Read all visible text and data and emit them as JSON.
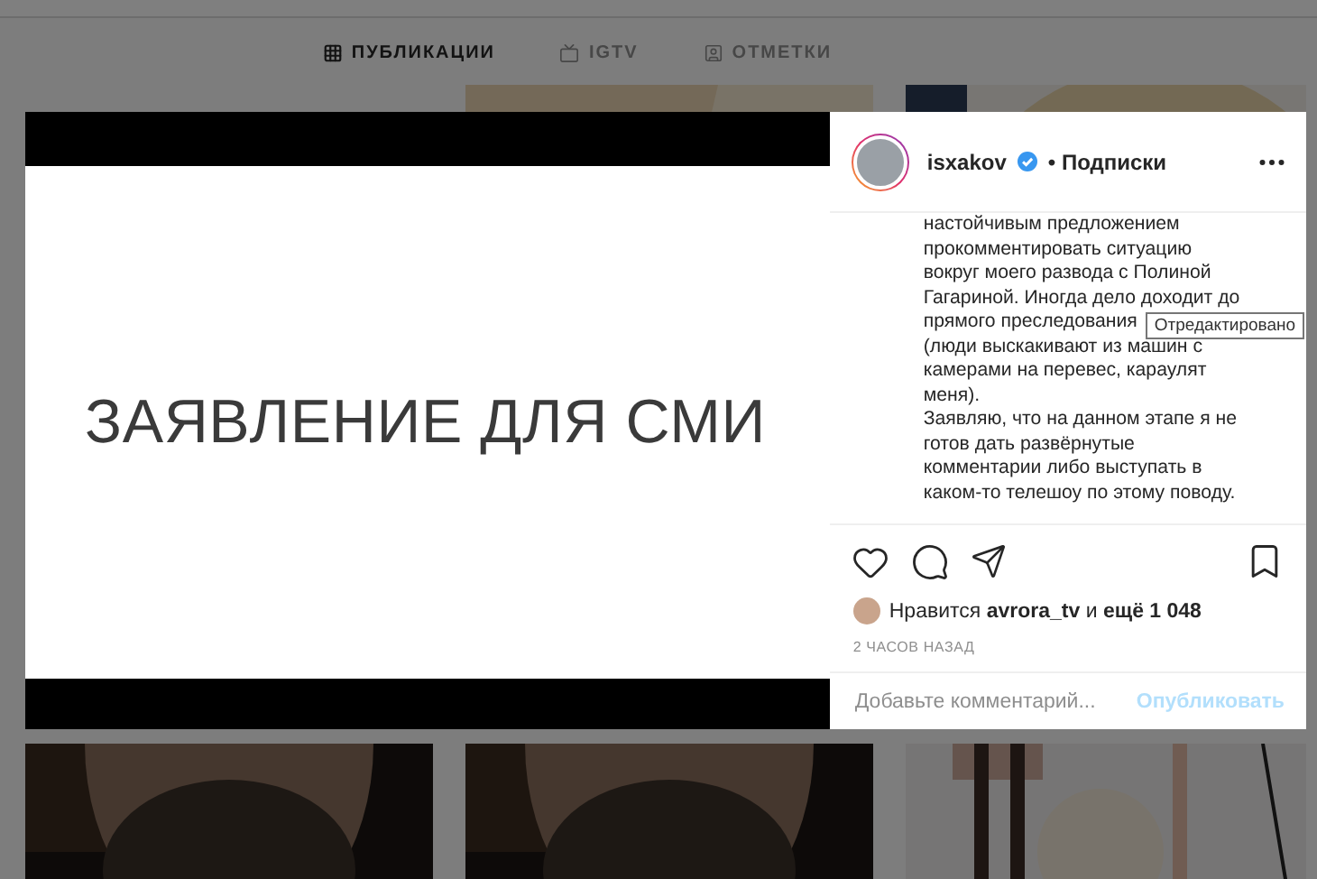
{
  "tabs": [
    {
      "label": "ПУБЛИКАЦИИ",
      "selected": true
    },
    {
      "label": "IGTV",
      "selected": false
    },
    {
      "label": "ОТМЕТКИ",
      "selected": false
    }
  ],
  "post": {
    "image_text": "ЗАЯВЛЕНИЕ ДЛЯ СМИ",
    "username": "isxakov",
    "verified": true,
    "follow": "• Подписки",
    "caption_lines": [
      "настойчивым предложением",
      "прокомментировать ситуацию",
      "вокруг моего развода с Полиной",
      "Гагариной. Иногда дело доходит до",
      "прямого преследования",
      "(люди выскакивают из машин с",
      "камерами на перевес, караулят",
      "меня).",
      "Заявляю, что на данном этапе я не",
      "готов дать развёрнутые",
      "комментарии либо выступать в",
      "каком-то телешоу по этому поводу."
    ],
    "tooltip": "Отредактировано",
    "liked": false,
    "saved": false,
    "likes_prefix": "Нравится",
    "likes_user": "avrora_tv",
    "likes_and": "и",
    "likes_count": "ещё 1 048",
    "time": "2 ЧАСОВ НАЗАД",
    "comment_placeholder": "Добавьте комментарий...",
    "publish": "Опубликовать"
  }
}
